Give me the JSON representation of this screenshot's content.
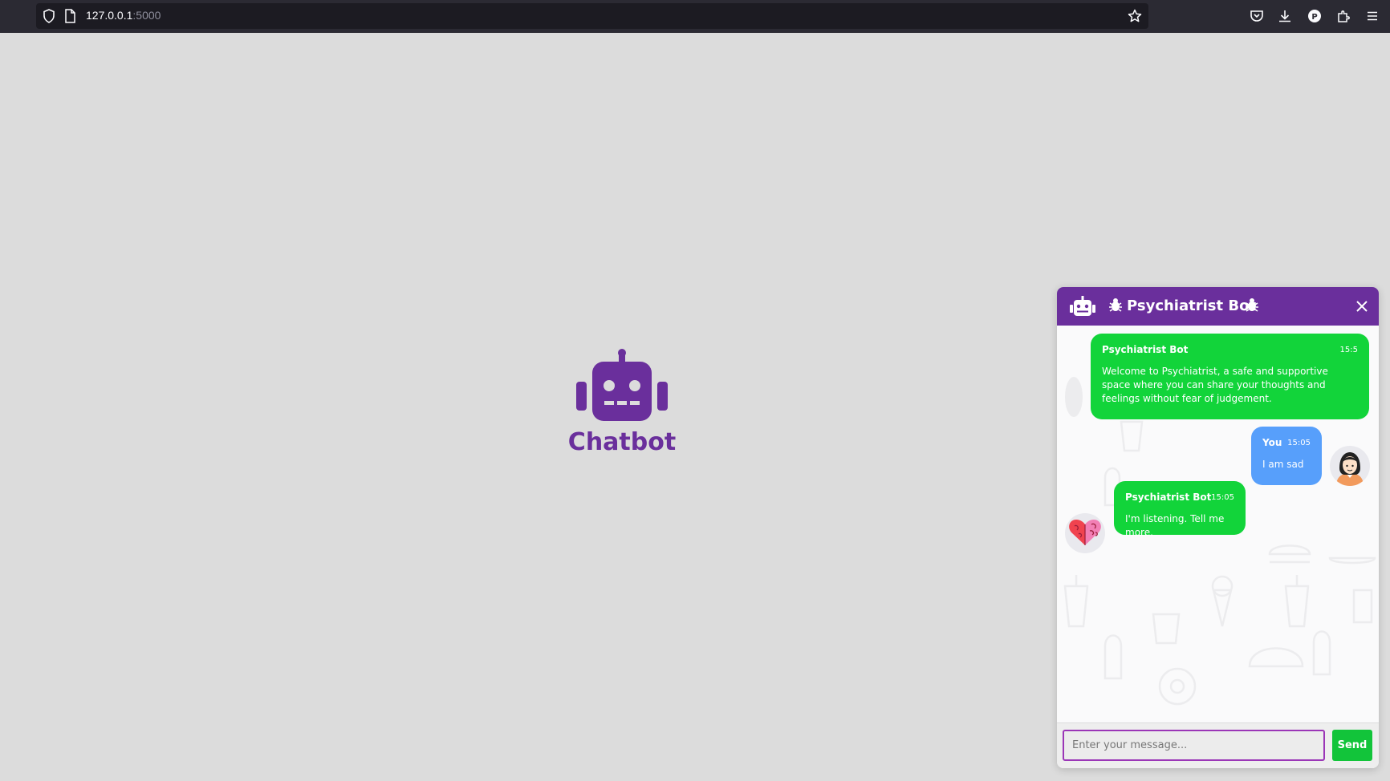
{
  "browser": {
    "url_host": "127.0.0.1",
    "url_port": ":5000",
    "icons": [
      "shield-icon",
      "page-icon",
      "bookmark-star-icon",
      "pocket-icon",
      "download-icon",
      "profile-icon",
      "extensions-icon",
      "menu-icon"
    ]
  },
  "center": {
    "title": "Chatbot",
    "icon": "robot-icon",
    "color": "#6a2f9c"
  },
  "chat": {
    "header": {
      "title": "Psychiatrist Bot",
      "icons": [
        "robot-icon",
        "bug-icon",
        "bug-icon",
        "close-icon"
      ],
      "color": "#6a2f9c"
    },
    "messages": [
      {
        "sender": "Psychiatrist Bot",
        "time": "15:5",
        "text": "Welcome to Psychiatrist, a safe and supportive space where you can share your thoughts and feelings without fear of judgement.",
        "side": "left"
      },
      {
        "sender": "You",
        "time": "15:05",
        "text": "I am sad",
        "side": "right"
      },
      {
        "sender": "Psychiatrist Bot",
        "time": "15:05",
        "text": "I'm listening. Tell me more.",
        "side": "left"
      }
    ],
    "input": {
      "placeholder": "Enter your message...",
      "value": ""
    },
    "send_label": "Send",
    "colors": {
      "bot_bubble": "#12d43a",
      "user_bubble": "#579ffb",
      "send_button": "#12c43a"
    }
  }
}
